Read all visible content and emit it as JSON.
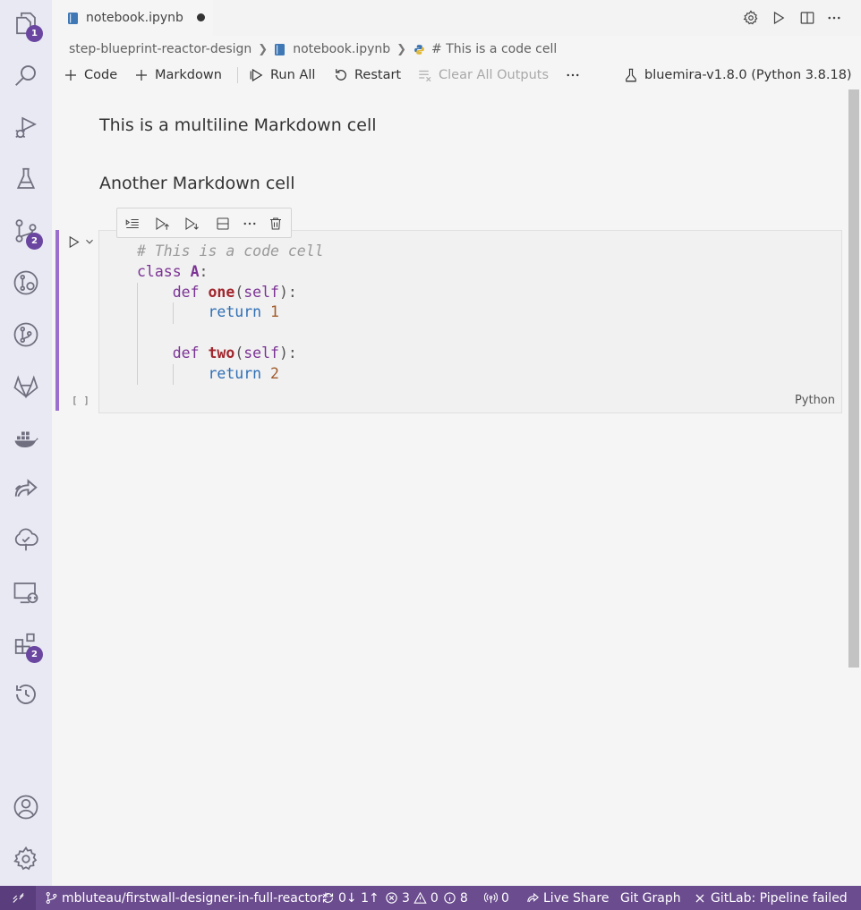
{
  "tab": {
    "title": "notebook.ipynb"
  },
  "breadcrumb": {
    "folder": "step-blueprint-reactor-design",
    "file": "notebook.ipynb",
    "cell": "# This is a code cell"
  },
  "toolbar": {
    "code": "Code",
    "markdown": "Markdown",
    "run_all": "Run All",
    "restart": "Restart",
    "clear_outputs": "Clear All Outputs",
    "kernel": "bluemira-v1.8.0 (Python 3.8.18)"
  },
  "cells": {
    "md1": "This is a multiline Markdown cell",
    "md2": "Another Markdown cell",
    "code": {
      "exec_count": "[ ]",
      "language": "Python",
      "comment": "# This is a code cell",
      "class_kw": "class",
      "class_name": "A",
      "def_kw": "def",
      "fn_one": "one",
      "fn_two": "two",
      "self": "self",
      "return_kw": "return",
      "num_one": "1",
      "num_two": "2"
    }
  },
  "activity_badges": {
    "explorer": "1",
    "source_control": "2",
    "extensions": "2"
  },
  "statusbar": {
    "branch": "mbluteau/firstwall-designer-in-full-reactor*",
    "sync": "0↓ 1↑",
    "errors": "3",
    "warnings": "0",
    "info": "8",
    "ports": "0",
    "live_share": "Live Share",
    "git_graph": "Git Graph",
    "gitlab": "GitLab: Pipeline failed"
  },
  "colors": {
    "accent": "#6b4c8f",
    "cell_bar": "#9b6fd0",
    "badge": "#6a46a0"
  }
}
